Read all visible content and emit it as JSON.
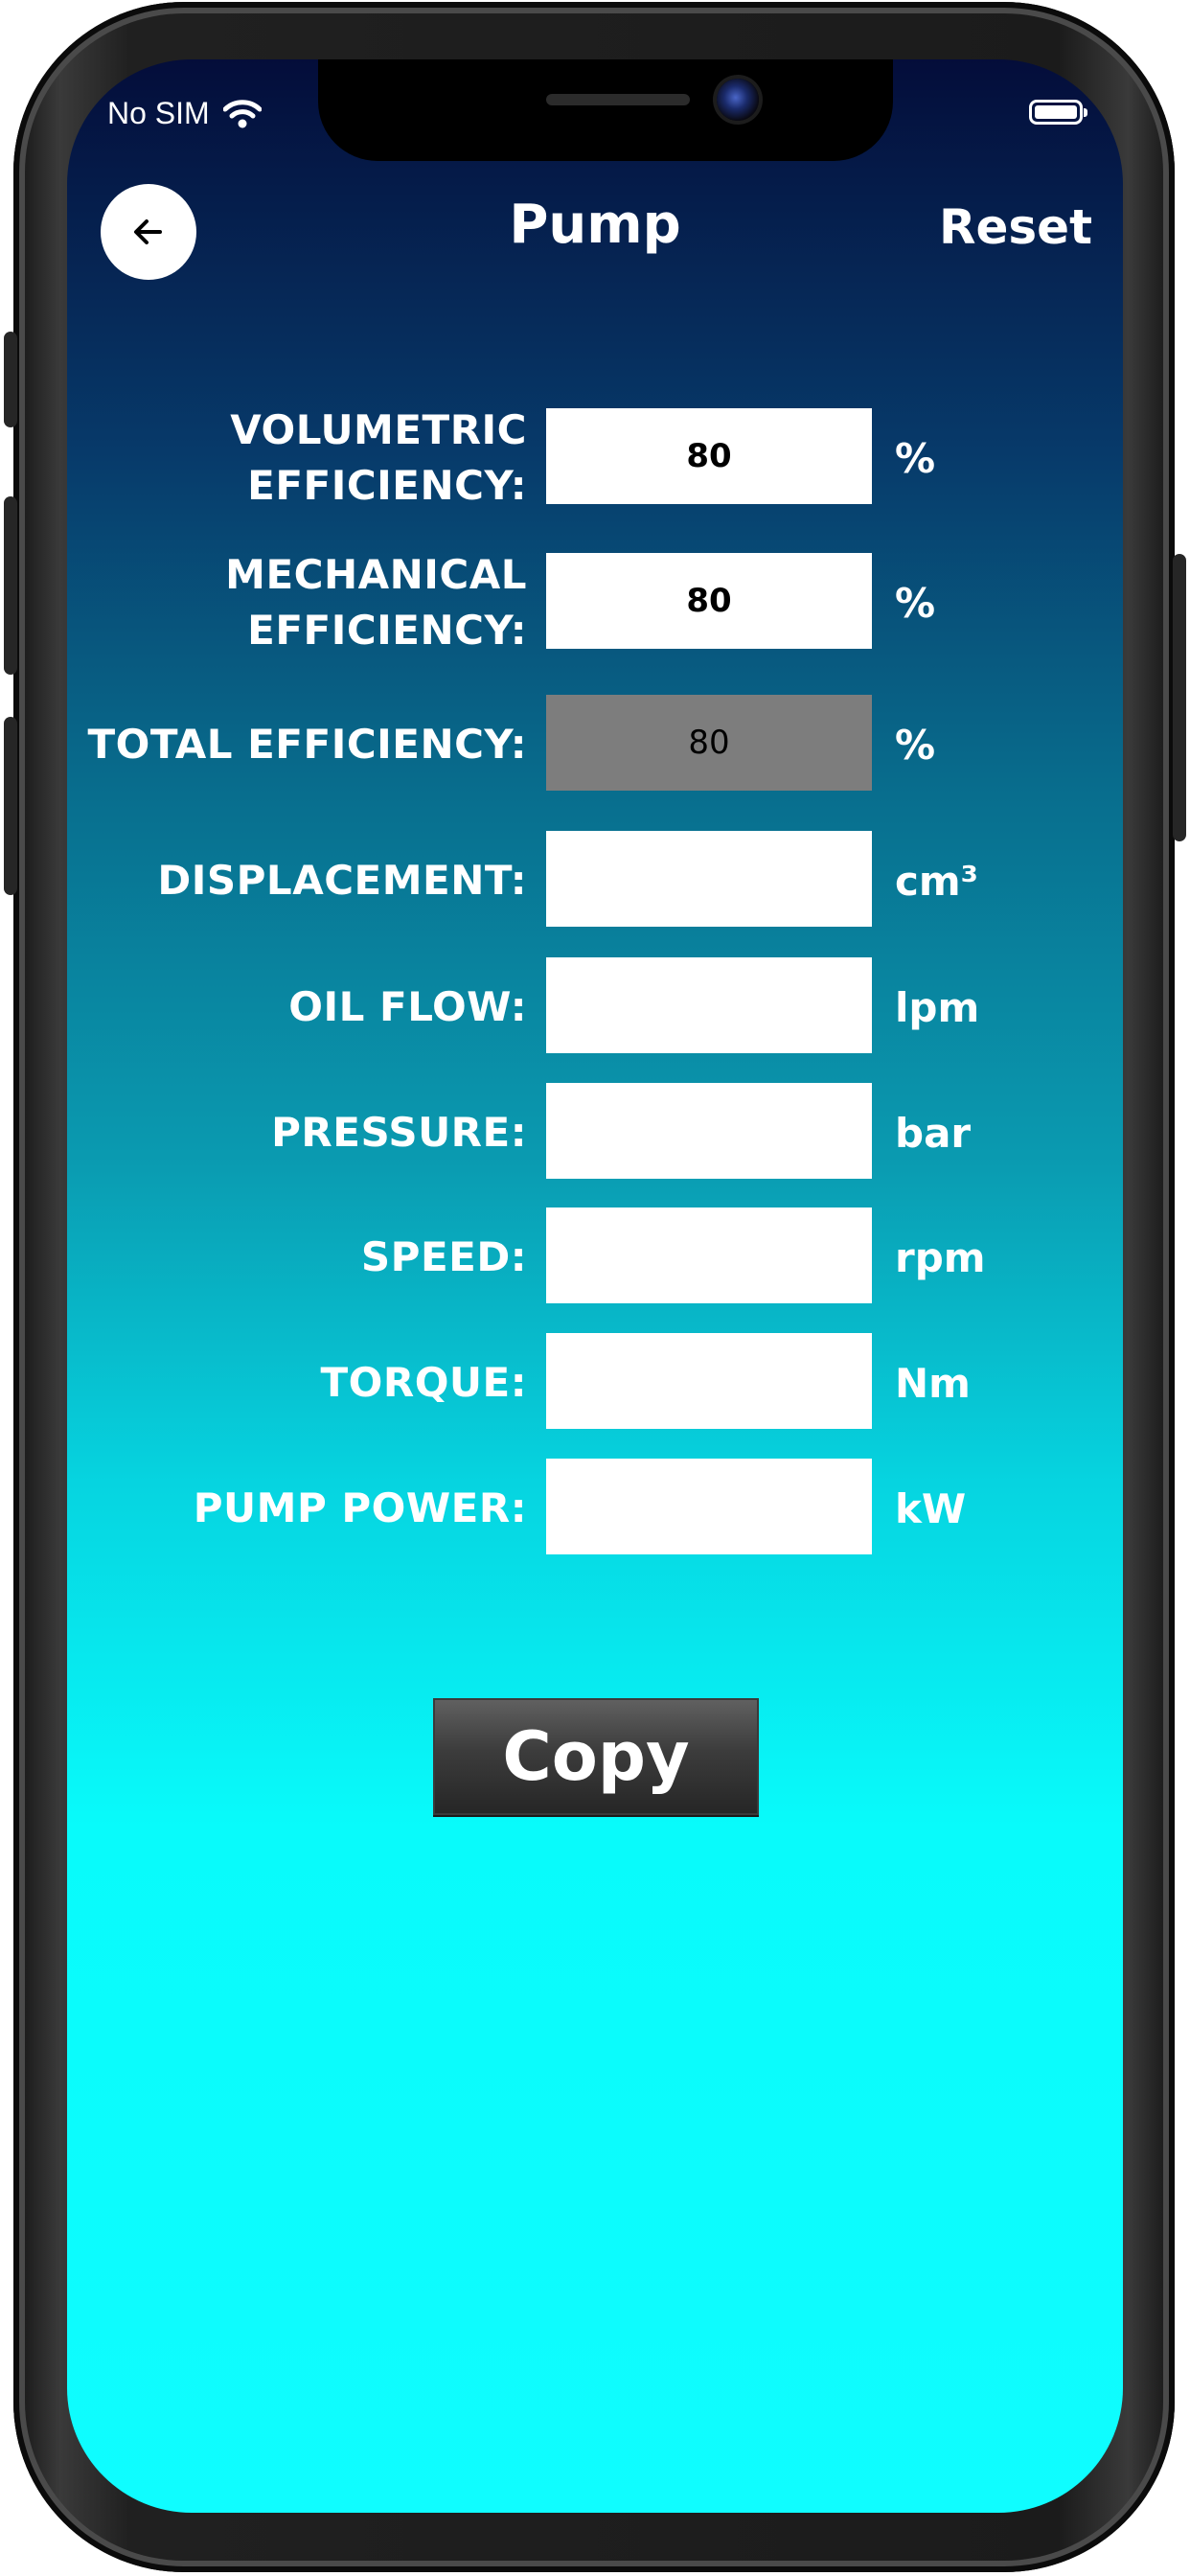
{
  "status_bar": {
    "carrier": "No SIM",
    "wifi_icon": "wifi-icon",
    "battery_icon": "battery-icon"
  },
  "header": {
    "back_icon": "arrow-left-icon",
    "title": "Pump",
    "reset_label": "Reset"
  },
  "form": {
    "rows": [
      {
        "label": "VOLUMETRIC EFFICIENCY:",
        "value": "80",
        "unit": "%",
        "enabled": true
      },
      {
        "label": "MECHANICAL EFFICIENCY:",
        "value": "80",
        "unit": "%",
        "enabled": true
      },
      {
        "label": "TOTAL EFFICIENCY:",
        "value": "80",
        "unit": "%",
        "enabled": false
      },
      {
        "label": "DISPLACEMENT:",
        "value": "",
        "unit": "cm³",
        "enabled": true
      },
      {
        "label": "OIL FLOW:",
        "value": "",
        "unit": "lpm",
        "enabled": true
      },
      {
        "label": "PRESSURE:",
        "value": "",
        "unit": "bar",
        "enabled": true
      },
      {
        "label": "SPEED:",
        "value": "",
        "unit": "rpm",
        "enabled": true
      },
      {
        "label": "TORQUE:",
        "value": "",
        "unit": "Nm",
        "enabled": true
      },
      {
        "label": "PUMP POWER:",
        "value": "",
        "unit": "kW",
        "enabled": true
      }
    ]
  },
  "copy_label": "Copy",
  "colors": {
    "gradient_top": "#040d3a",
    "gradient_bottom": "#0ffdff",
    "disabled_field": "#7d7d7d"
  }
}
